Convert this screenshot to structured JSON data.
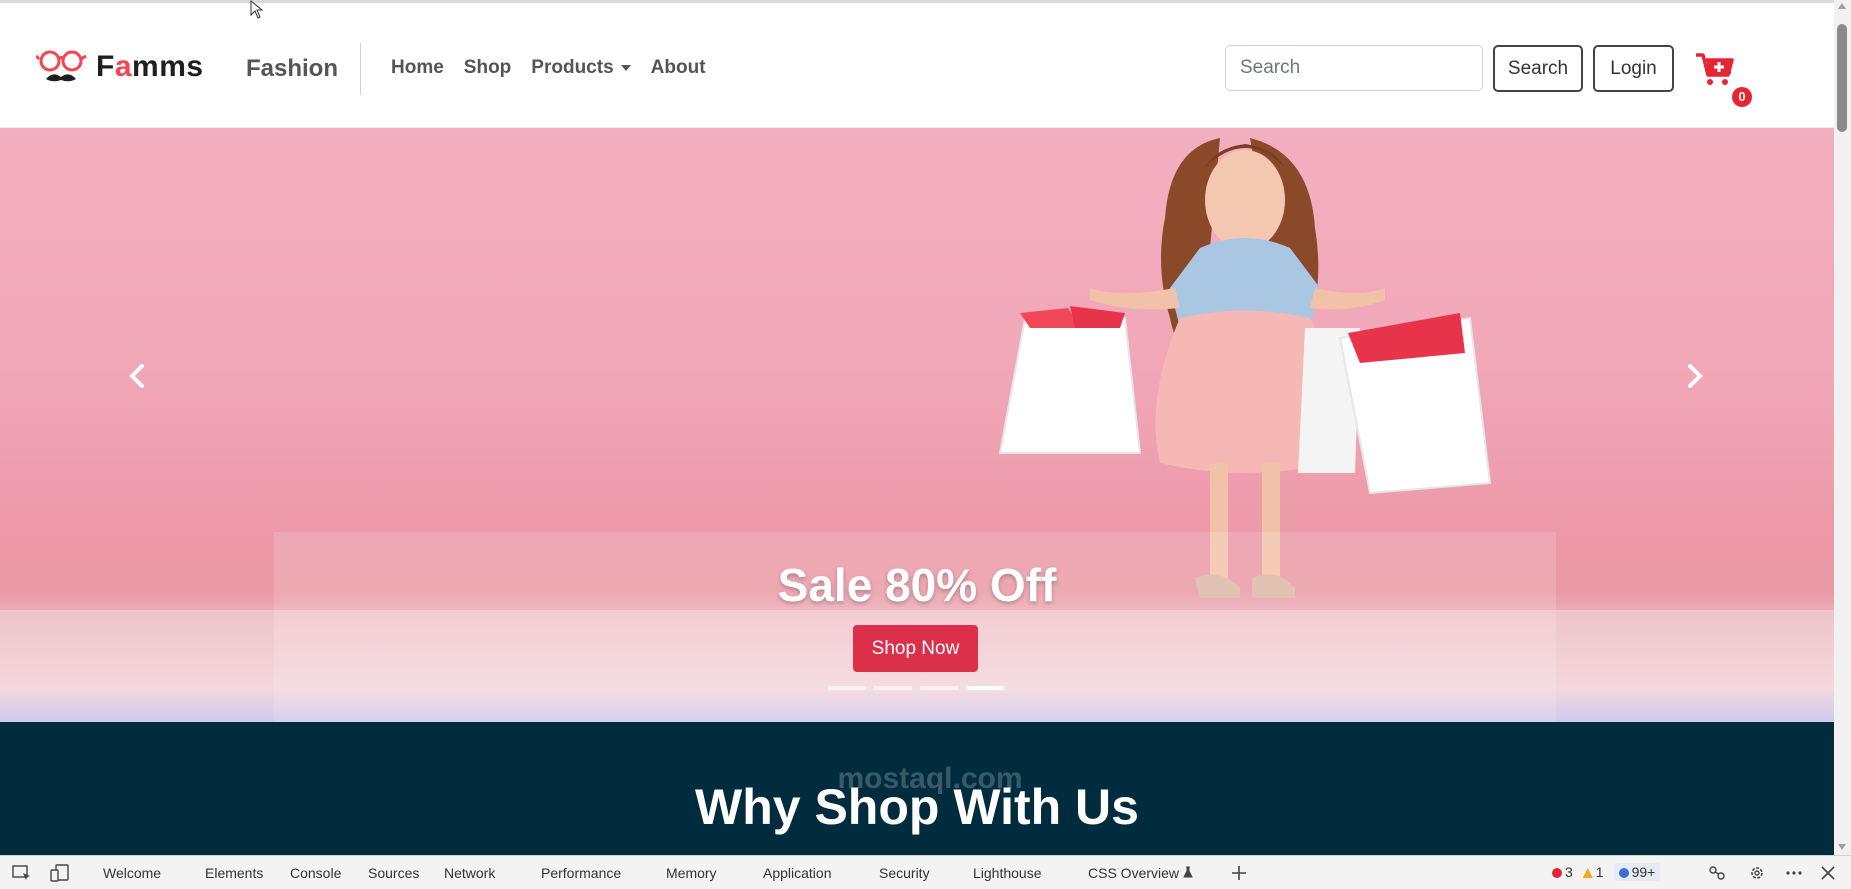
{
  "brand": {
    "name_prefix": "F",
    "name_accent": "a",
    "name_rest": "mms",
    "subtitle": "Fashion"
  },
  "nav": {
    "links": [
      "Home",
      "Shop",
      "Products",
      "About"
    ],
    "search_placeholder": "Search",
    "search_button": "Search",
    "login_button": "Login",
    "cart_count": "0"
  },
  "hero": {
    "caption_title": "Sale 80% Off",
    "cta_label": "Shop Now",
    "slide_count": 4,
    "active_slide": 4
  },
  "why": {
    "title": "Why Shop With Us",
    "watermark": "mostaql.com"
  },
  "devtools": {
    "tabs": [
      "Welcome",
      "Elements",
      "Console",
      "Sources",
      "Network",
      "Performance",
      "Memory",
      "Application",
      "Security",
      "Lighthouse",
      "CSS Overview"
    ],
    "errors": "3",
    "warnings": "1",
    "issues": "99+"
  },
  "colors": {
    "accent": "#f7444e",
    "cta": "#dc2f4a",
    "dark_section": "#002c3e",
    "badge": "#e52535"
  }
}
